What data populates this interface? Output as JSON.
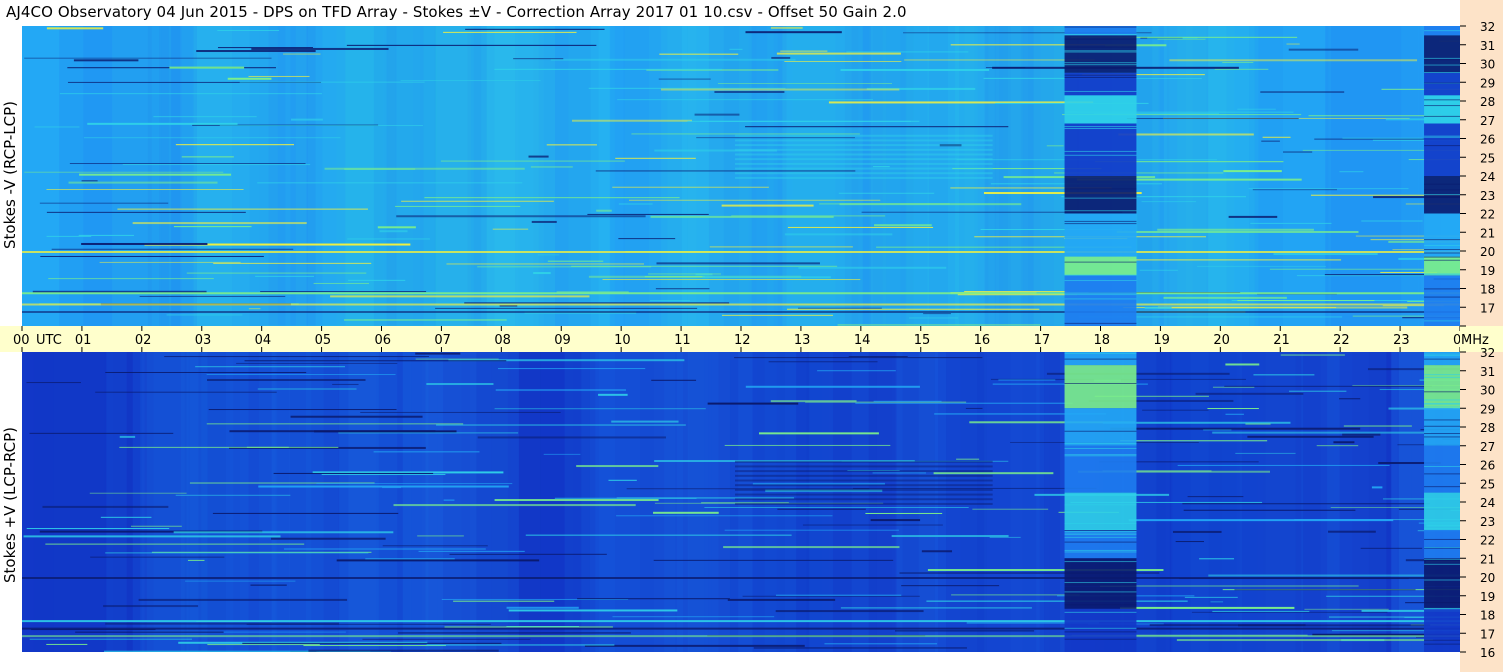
{
  "title": "AJ4CO Observatory  04 Jun 2015  -  DPS on TFD Array  -  Stokes ±V  -  Correction Array 2017 01 10.csv  -  Offset 50  Gain 2.0",
  "chart_data": [
    {
      "type": "heatmap",
      "name": "top-panel",
      "ylabel": "Stokes -V (RCP-LCP)",
      "x_unit": "UTC",
      "y_unit": "MHz",
      "x_range": [
        0,
        24
      ],
      "y_range": [
        16,
        32
      ],
      "colormap": [
        "#0a1a6e",
        "#1238c8",
        "#1e7cf0",
        "#23a8f5",
        "#2fd0e8",
        "#7cf08a",
        "#f0f040"
      ]
    },
    {
      "type": "heatmap",
      "name": "bottom-panel",
      "ylabel": "Stokes +V (LCP-RCP)",
      "x_unit": "UTC",
      "y_unit": "MHz",
      "x_range": [
        0,
        24
      ],
      "y_range": [
        16,
        32
      ],
      "colormap": [
        "#0a1a6e",
        "#1238c8",
        "#1e7cf0",
        "#23a8f5",
        "#2fd0e8",
        "#7cf08a",
        "#f0f040"
      ]
    }
  ],
  "time_axis": {
    "ticks": [
      "00",
      "01",
      "02",
      "03",
      "04",
      "05",
      "06",
      "07",
      "08",
      "09",
      "10",
      "11",
      "12",
      "13",
      "14",
      "15",
      "16",
      "17",
      "18",
      "19",
      "20",
      "21",
      "22",
      "23",
      "00"
    ],
    "unit_left": "UTC",
    "unit_right": "MHz"
  },
  "freq_axis": {
    "ticks": [
      "32",
      "31",
      "30",
      "29",
      "28",
      "27",
      "26",
      "25",
      "24",
      "23",
      "22",
      "21",
      "20",
      "19",
      "18",
      "17",
      "16"
    ]
  }
}
